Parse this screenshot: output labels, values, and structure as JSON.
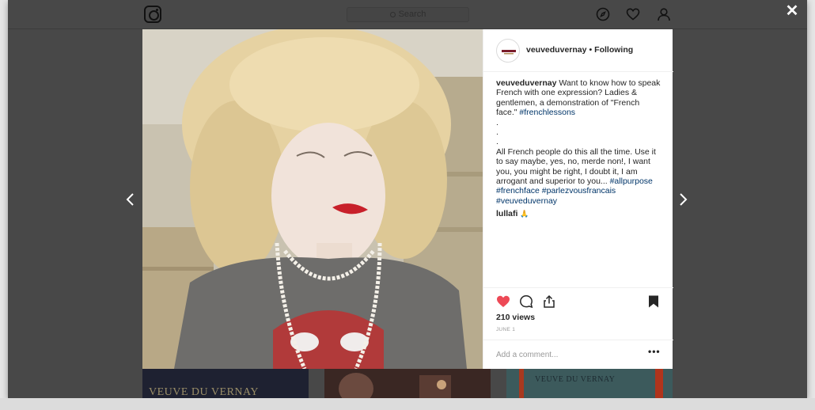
{
  "header": {
    "search_placeholder": "Search"
  },
  "post": {
    "username": "veuveduvernay",
    "follow_status": "Following",
    "separator": "•",
    "caption": {
      "text_1": "Want to know how to speak French with one expression? Ladies & gentlemen, a demonstration of \"French face.\"",
      "tag_1": "#frenchlessons",
      "dot_1": ".",
      "dot_2": ".",
      "dot_3": ".",
      "text_2": "All French people do this all the time. Use it to say maybe, yes, no, merde non!, I want you, you might be right, I doubt it, I am arrogant and superior to you...",
      "tag_2": "#allpurpose",
      "tag_3": "#frenchface",
      "tag_4": "#parlezvousfrancais",
      "tag_5": "#veuveduvernay"
    },
    "comment": {
      "username": "lullafi",
      "emoji": "🙏"
    },
    "views": "210 views",
    "date": "JUNE 1",
    "add_comment_placeholder": "Add a comment...",
    "more_label": "•••"
  },
  "overlay": {
    "close_label": "✕"
  },
  "thumbnails": [
    {
      "text": "VEUVE DU VERNAY"
    },
    {
      "text": ""
    },
    {
      "text": "VEUVE DU VERNAY"
    }
  ],
  "colors": {
    "like_red": "#ed4956",
    "tag_blue": "#003569",
    "overlay_dark": "#484848"
  },
  "icons": {
    "logo": "instagram-logo-icon",
    "explore": "compass-icon",
    "activity": "heart-icon",
    "profile": "person-icon",
    "close": "close-icon",
    "prev": "chevron-left-icon",
    "next": "chevron-right-icon",
    "like": "heart-filled-icon",
    "comment": "comment-bubble-icon",
    "share": "share-icon",
    "save": "bookmark-icon"
  }
}
